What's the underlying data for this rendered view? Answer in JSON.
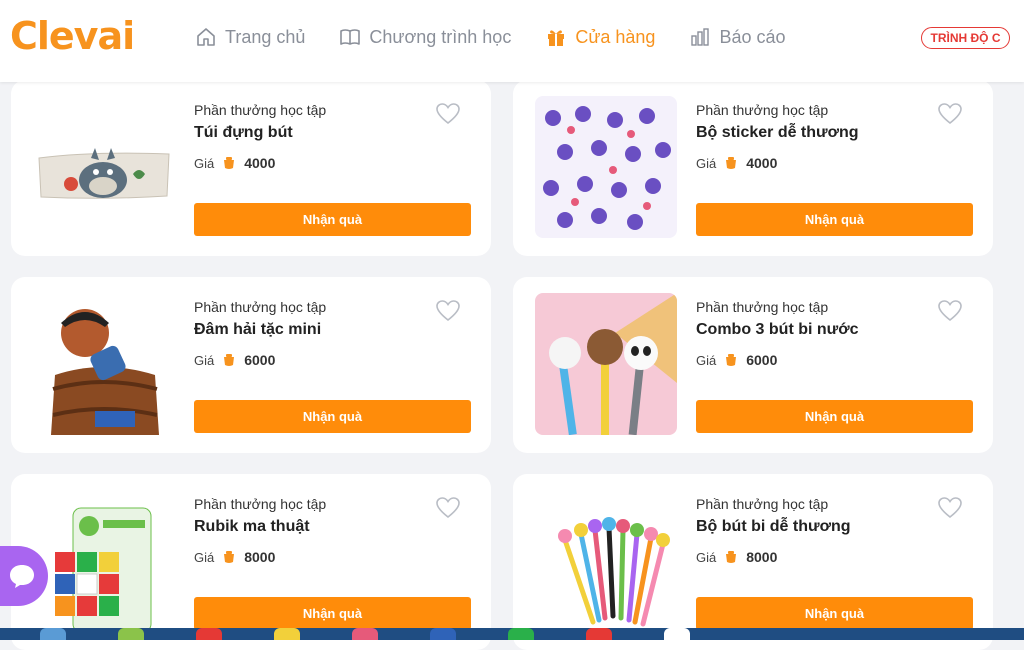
{
  "brand": {
    "logo_text": "Clevai",
    "accent": "#f7931e"
  },
  "nav": {
    "items": [
      {
        "label": "Trang chủ",
        "icon": "home-icon",
        "active": false
      },
      {
        "label": "Chương trình học",
        "icon": "book-icon",
        "active": false
      },
      {
        "label": "Cửa hàng",
        "icon": "gift-icon",
        "active": true
      },
      {
        "label": "Báo cáo",
        "icon": "chart-icon",
        "active": false
      }
    ]
  },
  "level_badge": "TRÌNH ĐỘ C",
  "products": [
    {
      "category": "Phần thưởng học tập",
      "title": "Túi đựng bút",
      "price_label": "Giá",
      "price": "4000",
      "button": "Nhận quà",
      "image": "pencil-case-image"
    },
    {
      "category": "Phần thưởng học tập",
      "title": "Bộ sticker dễ thương",
      "price_label": "Giá",
      "price": "4000",
      "button": "Nhận quà",
      "image": "sticker-set-image"
    },
    {
      "category": "Phần thưởng học tập",
      "title": "Đâm hải tặc mini",
      "price_label": "Giá",
      "price": "6000",
      "button": "Nhận quà",
      "image": "pirate-barrel-image"
    },
    {
      "category": "Phần thưởng học tập",
      "title": "Combo 3 bút bi nước",
      "price_label": "Giá",
      "price": "6000",
      "button": "Nhận quà",
      "image": "bear-pens-image"
    },
    {
      "category": "Phần thưởng học tập",
      "title": "Rubik ma thuật",
      "price_label": "Giá",
      "price": "8000",
      "button": "Nhận quà",
      "image": "magic-cube-image"
    },
    {
      "category": "Phần thưởng học tập",
      "title": "Bộ bút bi dễ thương",
      "price_label": "Giá",
      "price": "8000",
      "button": "Nhận quà",
      "image": "cute-pens-image"
    }
  ],
  "colors": {
    "button": "#ff8c0a",
    "badge": "#e53935",
    "chat": "#a965f0"
  }
}
